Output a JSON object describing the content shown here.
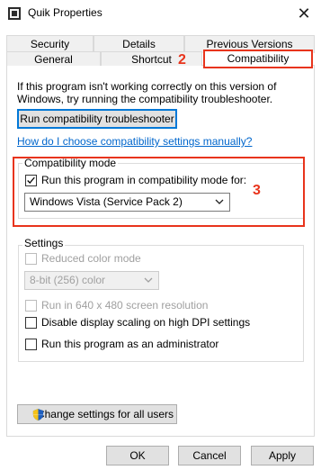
{
  "window": {
    "title": "Quik Properties"
  },
  "tabs": {
    "row1": [
      "Security",
      "Details",
      "Previous Versions"
    ],
    "row2": [
      "General",
      "Shortcut",
      "Compatibility"
    ]
  },
  "annotations": [
    "2",
    "3"
  ],
  "intro_text": "If this program isn't working correctly on this version of Windows, try running the compatibility troubleshooter.",
  "troubleshooter_button": "Run compatibility troubleshooter",
  "help_link": "How do I choose compatibility settings manually?",
  "compat_mode": {
    "label": "Compatibility mode",
    "checkbox_label": "Run this program in compatibility mode for:",
    "checked": true,
    "selected_os": "Windows Vista (Service Pack 2)"
  },
  "settings": {
    "label": "Settings",
    "reduced_color": "Reduced color mode",
    "color_option": "8-bit (256) color",
    "run_640": "Run in 640 x 480 screen resolution",
    "disable_dpi": "Disable display scaling on high DPI settings",
    "run_admin": "Run this program as an administrator"
  },
  "change_all_button": "Change settings for all users",
  "footer": {
    "ok": "OK",
    "cancel": "Cancel",
    "apply": "Apply"
  },
  "colors": {
    "accent": "#0078d7",
    "annotation": "#e8341c",
    "link": "#0066cc"
  },
  "icons": [
    "app-icon",
    "close-icon",
    "checkmark-icon",
    "chevron-down-icon",
    "shield-icon"
  ]
}
